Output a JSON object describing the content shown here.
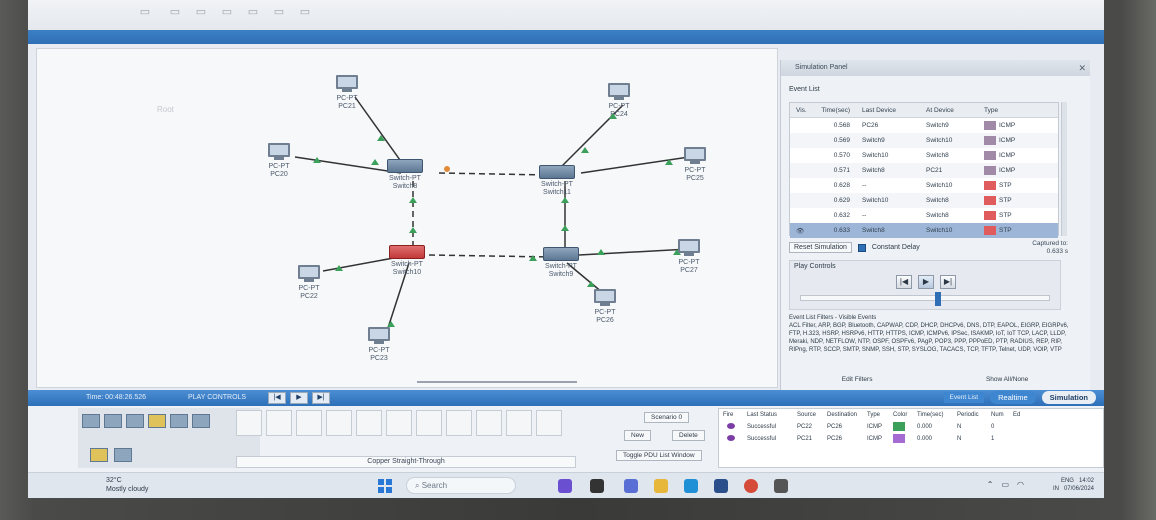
{
  "workspace": {
    "background_label": "Root",
    "nodes": [
      {
        "id": "pc21",
        "type": "pc",
        "line1": "PC-PT",
        "line2": "PC21"
      },
      {
        "id": "pc24",
        "type": "pc",
        "line1": "PC-PT",
        "line2": "PC24"
      },
      {
        "id": "pc20",
        "type": "pc",
        "line1": "PC-PT",
        "line2": "PC20"
      },
      {
        "id": "pc25",
        "type": "pc",
        "line1": "PC-PT",
        "line2": "PC25"
      },
      {
        "id": "switch8",
        "type": "switch",
        "line1": "Switch-PT",
        "line2": "Switch8"
      },
      {
        "id": "switch11",
        "type": "switch",
        "line1": "Switch-PT",
        "line2": "Switch11"
      },
      {
        "id": "switch10",
        "type": "switch",
        "line1": "Switch-PT",
        "line2": "Switch10"
      },
      {
        "id": "switch9",
        "type": "switch",
        "line1": "Switch-PT",
        "line2": "Switch9"
      },
      {
        "id": "pc22",
        "type": "pc",
        "line1": "PC-PT",
        "line2": "PC22"
      },
      {
        "id": "pc27",
        "type": "pc",
        "line1": "PC-PT",
        "line2": "PC27"
      },
      {
        "id": "pc26",
        "type": "pc",
        "line1": "PC-PT",
        "line2": "PC26"
      },
      {
        "id": "pc23",
        "type": "pc",
        "line1": "PC-PT",
        "line2": "PC23"
      }
    ]
  },
  "simulation_panel": {
    "title": "Simulation Panel",
    "event_list_label": "Event List",
    "columns": [
      "Vis.",
      "Time(sec)",
      "Last Device",
      "At Device",
      "Type"
    ],
    "events": [
      {
        "time": "0.568",
        "last": "PC26",
        "at": "Switch9",
        "type": "ICMP",
        "color": "#a08aa8"
      },
      {
        "time": "0.569",
        "last": "Switch9",
        "at": "Switch10",
        "type": "ICMP",
        "color": "#a08aa8"
      },
      {
        "time": "0.570",
        "last": "Switch10",
        "at": "Switch8",
        "type": "ICMP",
        "color": "#a08aa8"
      },
      {
        "time": "0.571",
        "last": "Switch8",
        "at": "PC21",
        "type": "ICMP",
        "color": "#a08aa8"
      },
      {
        "time": "0.628",
        "last": "--",
        "at": "Switch10",
        "type": "STP",
        "color": "#e05c5c"
      },
      {
        "time": "0.629",
        "last": "Switch10",
        "at": "Switch8",
        "type": "STP",
        "color": "#e05c5c"
      },
      {
        "time": "0.632",
        "last": "--",
        "at": "Switch8",
        "type": "STP",
        "color": "#e05c5c"
      },
      {
        "time": "0.633",
        "last": "Switch8",
        "at": "Switch10",
        "type": "STP",
        "color": "#e05c5c"
      }
    ],
    "reset_label": "Reset Simulation",
    "constant_delay_label": "Constant Delay",
    "captured_label": "Captured to:",
    "captured_value": "0.633 s",
    "play_controls_label": "Play Controls",
    "play_buttons": [
      "|◀",
      "▶",
      "▶|"
    ],
    "slider_level": 0.55,
    "filters_title": "Event List Filters - Visible Events",
    "filters_text": "ACL Filter, ARP, BGP, Bluetooth, CAPWAP, CDP, DHCP, DHCPv6, DNS, DTP, EAPOL, EIGRP, EIGRPv6, FTP, H.323, HSRP, HSRPv6, HTTP, HTTPS, ICMP, ICMPv6, IPSec, ISAKMP, IoT, IoT TCP, LACP, LLDP, Meraki, NDP, NETFLOW, NTP, OSPF, OSPFv6, PAgP, POP3, PPP, PPPoED, PTP, RADIUS, REP, RIP, RIPng, RTP, SCCP, SMTP, SNMP, SSH, STP, SYSLOG, TACACS, TCP, TFTP, Telnet, UDP, VOIP, VTP",
    "edit_filters": "Edit Filters",
    "show_all_none": "Show All/None"
  },
  "mode_bar": {
    "time": "Time: 00:48:26.526",
    "play_controls": "PLAY CONTROLS",
    "event_list": "Event List",
    "realtime": "Realtime",
    "simulation": "Simulation"
  },
  "bottom": {
    "cable_label": "Copper Straight-Through",
    "scenario": "Scenario 0",
    "new": "New",
    "delete": "Delete",
    "toggle_pdu": "Toggle PDU List Window",
    "pdu_columns": [
      "Fire",
      "Last Status",
      "Source",
      "Destination",
      "Type",
      "Color",
      "Time(sec)",
      "Periodic",
      "Num",
      "Ed"
    ],
    "pdu_rows": [
      {
        "status": "Successful",
        "source": "PC22",
        "dest": "PC26",
        "type": "ICMP",
        "color": "#3aa05a",
        "time": "0.000",
        "periodic": "N",
        "num": "0"
      },
      {
        "status": "Successful",
        "source": "PC21",
        "dest": "PC26",
        "type": "ICMP",
        "color": "#a66bd3",
        "time": "0.000",
        "periodic": "N",
        "num": "1"
      }
    ]
  },
  "taskbar": {
    "temp": "32°C",
    "weather": "Mostly cloudy",
    "search": "Search",
    "lang1": "ENG",
    "lang2": "IN",
    "time": "14:02",
    "date": "07/06/2024"
  }
}
